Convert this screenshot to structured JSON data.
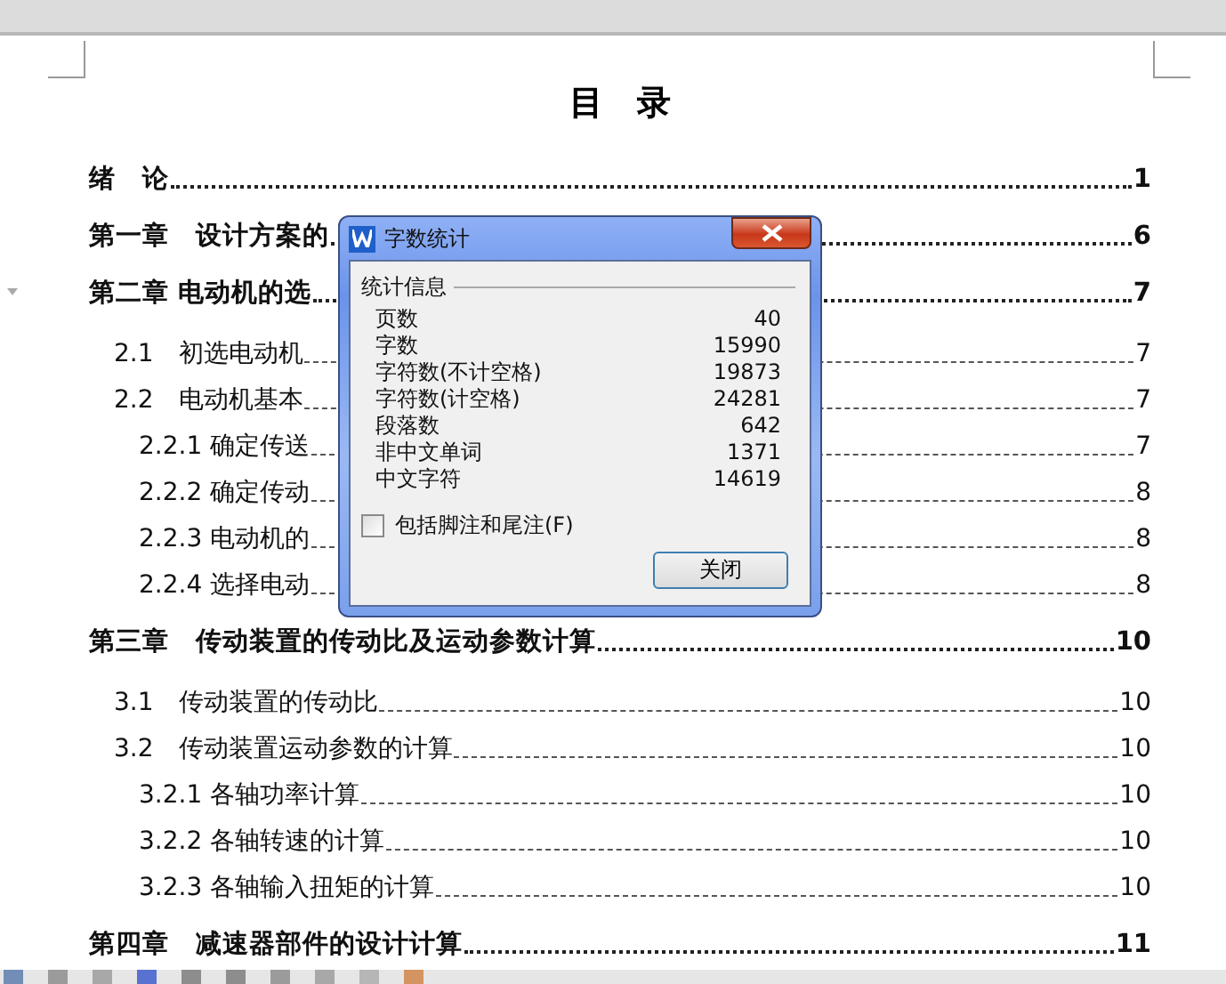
{
  "document": {
    "title": "目　录",
    "toc": [
      {
        "kind": "chapter",
        "title": "绪　论",
        "page": "1"
      },
      {
        "kind": "chapter",
        "title": "第一章　设计方案的",
        "page": "6"
      },
      {
        "kind": "chapter",
        "title": "第二章  电动机的选",
        "page": "7"
      },
      {
        "kind": "section",
        "title": "2.1　初选电动机",
        "page": "7"
      },
      {
        "kind": "section",
        "title": "2.2　电动机基本",
        "page": "7"
      },
      {
        "kind": "subsection",
        "title": "2.2.1 确定传送",
        "page": "7"
      },
      {
        "kind": "subsection",
        "title": "2.2.2 确定传动",
        "page": "8"
      },
      {
        "kind": "subsection",
        "title": "2.2.3 电动机的",
        "page": "8"
      },
      {
        "kind": "subsection",
        "title": "2.2.4 选择电动",
        "page": "8"
      },
      {
        "kind": "chapter",
        "title": "第三章　传动装置的传动比及运动参数计算",
        "page": "10"
      },
      {
        "kind": "section",
        "title": "3.1　传动装置的传动比",
        "page": "10"
      },
      {
        "kind": "section",
        "title": "3.2　传动装置运动参数的计算",
        "page": "10"
      },
      {
        "kind": "subsection",
        "title": "3.2.1 各轴功率计算",
        "page": "10"
      },
      {
        "kind": "subsection",
        "title": "3.2.2 各轴转速的计算",
        "page": "10"
      },
      {
        "kind": "subsection",
        "title": "3.2.3 各轴输入扭矩的计算",
        "page": "10"
      },
      {
        "kind": "chapter",
        "title": "第四章　减速器部件的设计计算",
        "page": "11"
      }
    ]
  },
  "dialog": {
    "title": "字数统计",
    "group_label": "统计信息",
    "stats": [
      {
        "label": "页数",
        "value": "40"
      },
      {
        "label": "字数",
        "value": "15990"
      },
      {
        "label": "字符数(不计空格)",
        "value": "19873"
      },
      {
        "label": "字符数(计空格)",
        "value": "24281"
      },
      {
        "label": "段落数",
        "value": "642"
      },
      {
        "label": "非中文单词",
        "value": "1371"
      },
      {
        "label": "中文字符",
        "value": "14619"
      }
    ],
    "checkbox": {
      "label": "包括脚注和尾注(F)",
      "checked": false
    },
    "close_button": "关闭"
  }
}
